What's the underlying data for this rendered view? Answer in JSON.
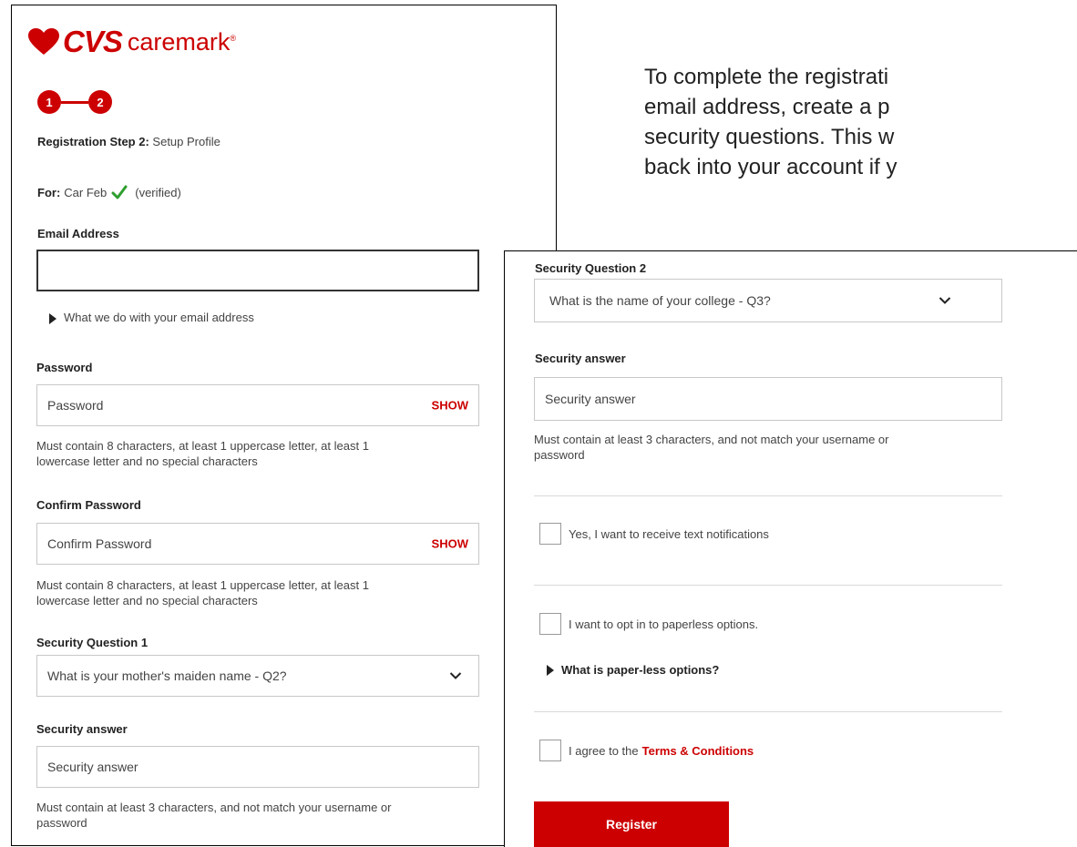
{
  "brand": {
    "name": "CVS",
    "suffix": "caremark",
    "registered": "®"
  },
  "stepper": {
    "step1": "1",
    "step2": "2"
  },
  "step_title": {
    "bold": "Registration Step 2:",
    "rest": "Setup Profile"
  },
  "for_line": {
    "bold": "For:",
    "name": "Car Feb",
    "status": "(verified)"
  },
  "email": {
    "label": "Email Address",
    "value": "",
    "info_link": "What we do with your email address"
  },
  "password": {
    "label": "Password",
    "placeholder": "Password",
    "show": "SHOW",
    "hint": [
      "Must contain 8 characters, at least 1 uppercase letter, at least 1",
      "lowercase letter and no special characters"
    ]
  },
  "confirm_password": {
    "label": "Confirm Password",
    "placeholder": "Confirm Password",
    "show": "SHOW",
    "hint": [
      "Must contain 8 characters, at least 1 uppercase letter, at least 1",
      "lowercase letter and no special characters"
    ]
  },
  "security_q1": {
    "label": "Security Question 1",
    "selected": "What is your mother's maiden name - Q2?"
  },
  "security_answer_1": {
    "label": "Security answer",
    "placeholder": "Security answer",
    "hint": [
      "Must contain at least 3 characters, and not match your username or",
      "password"
    ]
  },
  "security_q2": {
    "label": "Security Question 2",
    "selected": "What is the name of your college - Q3?"
  },
  "security_answer_2": {
    "label": "Security answer",
    "placeholder": "Security answer",
    "hint": [
      "Must contain at least 3 characters, and not match your username or",
      "password"
    ]
  },
  "text_notifications": {
    "label": "Yes, I want to receive text notifications",
    "checked": false
  },
  "paperless": {
    "label": "I want to opt in to paperless options.",
    "checked": false,
    "info_link": "What is paper-less options?"
  },
  "terms": {
    "prefix": "I agree to the",
    "link": "Terms & Conditions",
    "checked": false
  },
  "register_button": "Register",
  "intro_text": [
    "To complete the registrati",
    "email address, create a p",
    "security questions. This w",
    "back into your account if y"
  ],
  "colors": {
    "accent": "#cc0000",
    "check": "#2e9e2e",
    "border": "#c8c8c8"
  },
  "icons": [
    "heart-logo-icon",
    "checkmark-icon",
    "caret-right-icon",
    "chevron-down-icon"
  ]
}
